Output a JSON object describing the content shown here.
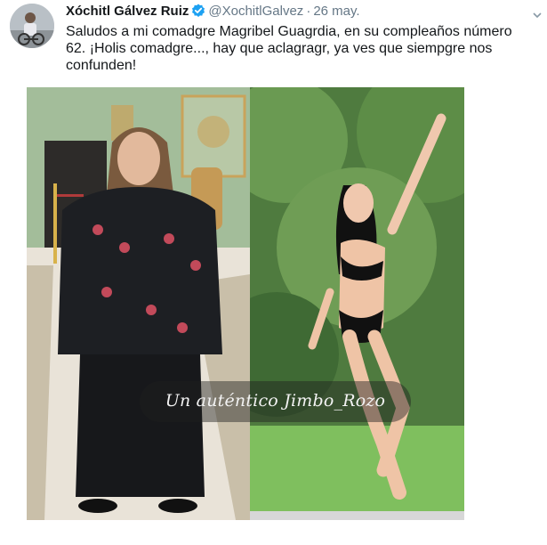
{
  "tweet": {
    "display_name": "Xóchitl Gálvez Ruiz",
    "handle": "@XochitlGalvez",
    "separator": "·",
    "date": "26 may.",
    "text": "Saludos a mi comadgre Magribel Guagrdia, en su compleaños número 62. ¡Holis comadgre..., hay que aclagragr, ya ves que siempgre nos confunden!"
  },
  "icons": {
    "verified": "verified-badge-icon",
    "menu": "chevron-down-icon"
  },
  "watermark": {
    "text": "Un auténtico Jimbo_Rozo"
  },
  "colors": {
    "verified_blue": "#1da1f2",
    "name_text": "#14171a",
    "secondary_text": "#657786"
  }
}
